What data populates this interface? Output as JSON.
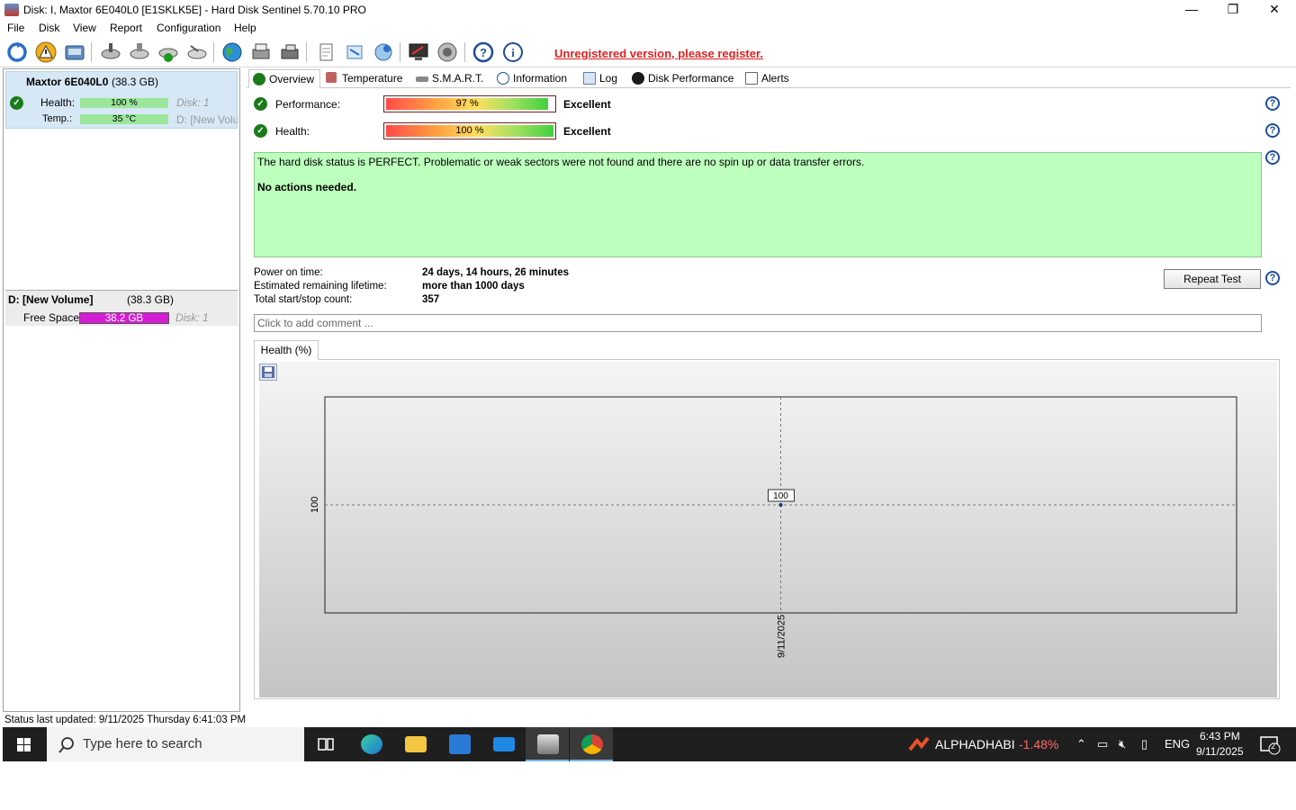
{
  "window": {
    "title": "Disk: I, Maxtor 6E040L0 [E1SKLK5E]  -  Hard Disk Sentinel 5.70.10 PRO",
    "controls": {
      "minimize": "—",
      "restore": "❐",
      "close": "✕"
    }
  },
  "menu": {
    "file": "File",
    "disk": "Disk",
    "view": "View",
    "report": "Report",
    "configuration": "Configuration",
    "help": "Help"
  },
  "toolbar": {
    "unregistered": "Unregistered version, please register."
  },
  "disk": {
    "name": "Maxtor 6E040L0",
    "size": "(38.3 GB)",
    "health_label": "Health:",
    "health_value": "100 %",
    "health_pct": 100,
    "disk_no": "Disk: 1",
    "temp_label": "Temp.:",
    "temp_value": "35 °C",
    "temp_pct": 100,
    "volume_ref": "D: [New Volu"
  },
  "volume": {
    "name": "D: [New Volume]",
    "size": "(38.3 GB)",
    "free_label": "Free Space",
    "free_value": "38.2 GB",
    "free_pct": 100,
    "disk_no": "Disk: 1"
  },
  "tabs": {
    "overview": "Overview",
    "temperature": "Temperature",
    "smart": "S.M.A.R.T.",
    "information": "Information",
    "log": "Log",
    "performance": "Disk Performance",
    "alerts": "Alerts"
  },
  "overview": {
    "performance_label": "Performance:",
    "performance_value": "97 %",
    "performance_pct": 97,
    "performance_rating": "Excellent",
    "health_label": "Health:",
    "health_value": "100 %",
    "health_pct": 100,
    "health_rating": "Excellent",
    "status_text": "The hard disk status is PERFECT. Problematic or weak sectors were not found and there are no spin up or data transfer errors.",
    "actions_text": "No actions needed.",
    "power_on_label": "Power on time:",
    "power_on_value": "24 days, 14 hours, 26 minutes",
    "lifetime_label": "Estimated remaining lifetime:",
    "lifetime_value": "more than 1000 days",
    "startstop_label": "Total start/stop count:",
    "startstop_value": "357",
    "repeat_test": "Repeat Test",
    "comment_placeholder": "Click to add comment ..."
  },
  "graph": {
    "tab_label": "Health (%)"
  },
  "chart_data": {
    "type": "line",
    "x": [
      "9/11/2025"
    ],
    "series": [
      {
        "values": [
          100
        ]
      }
    ],
    "y_tick_labels": [
      "100"
    ],
    "data_labels": [
      "100"
    ],
    "grid": true
  },
  "statusbar": {
    "text": "Status last updated: 9/11/2025 Thursday 6:41:03 PM"
  },
  "taskbar": {
    "search_placeholder": "Type here to search",
    "ticker_name": "ALPHADHABI",
    "ticker_change": "-1.48%",
    "language": "ENG",
    "time": "6:43 PM",
    "date": "9/11/2025",
    "notification_count": "2",
    "colors": {
      "ticker_negative": "#ff6b6b",
      "accent": "#7eb2e6"
    }
  }
}
